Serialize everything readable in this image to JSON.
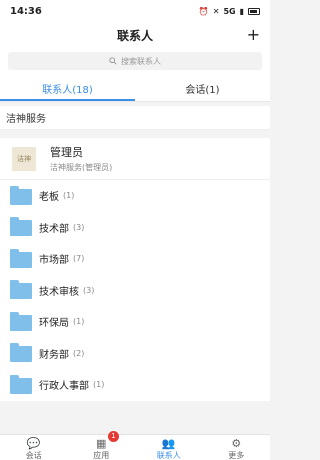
{
  "status_bar": {
    "time": "14:36",
    "signal": "5G",
    "icons": [
      "alarm-icon",
      "mute-icon",
      "signal-icon",
      "battery-icon"
    ]
  },
  "header": {
    "title": "联系人",
    "add_label": "+"
  },
  "search": {
    "placeholder": "搜索联系人"
  },
  "tabs": [
    {
      "label": "联系人(18)",
      "active": true
    },
    {
      "label": "会话(1)",
      "active": false
    }
  ],
  "org": {
    "name": "洁神服务"
  },
  "member": {
    "name": "管理员",
    "subtitle": "洁神服务(管理员)",
    "avatar_text": "洁神"
  },
  "departments": [
    {
      "name": "老板",
      "count": "(1)"
    },
    {
      "name": "技术部",
      "count": "(3)"
    },
    {
      "name": "市场部",
      "count": "(7)"
    },
    {
      "name": "技术审核",
      "count": "(3)"
    },
    {
      "name": "环保局",
      "count": "(1)"
    },
    {
      "name": "财务部",
      "count": "(2)"
    },
    {
      "name": "行政人事部",
      "count": "(1)"
    }
  ],
  "bottom_nav": [
    {
      "label": "会话",
      "icon": "chat-icon"
    },
    {
      "label": "应用",
      "icon": "apps-icon",
      "badge": "1"
    },
    {
      "label": "联系人",
      "icon": "contacts-icon",
      "active": true
    },
    {
      "label": "更多",
      "icon": "gear-icon"
    }
  ],
  "colors": {
    "accent": "#3a8ee6",
    "folder": "#7fbfe9",
    "badge": "#e53935"
  }
}
